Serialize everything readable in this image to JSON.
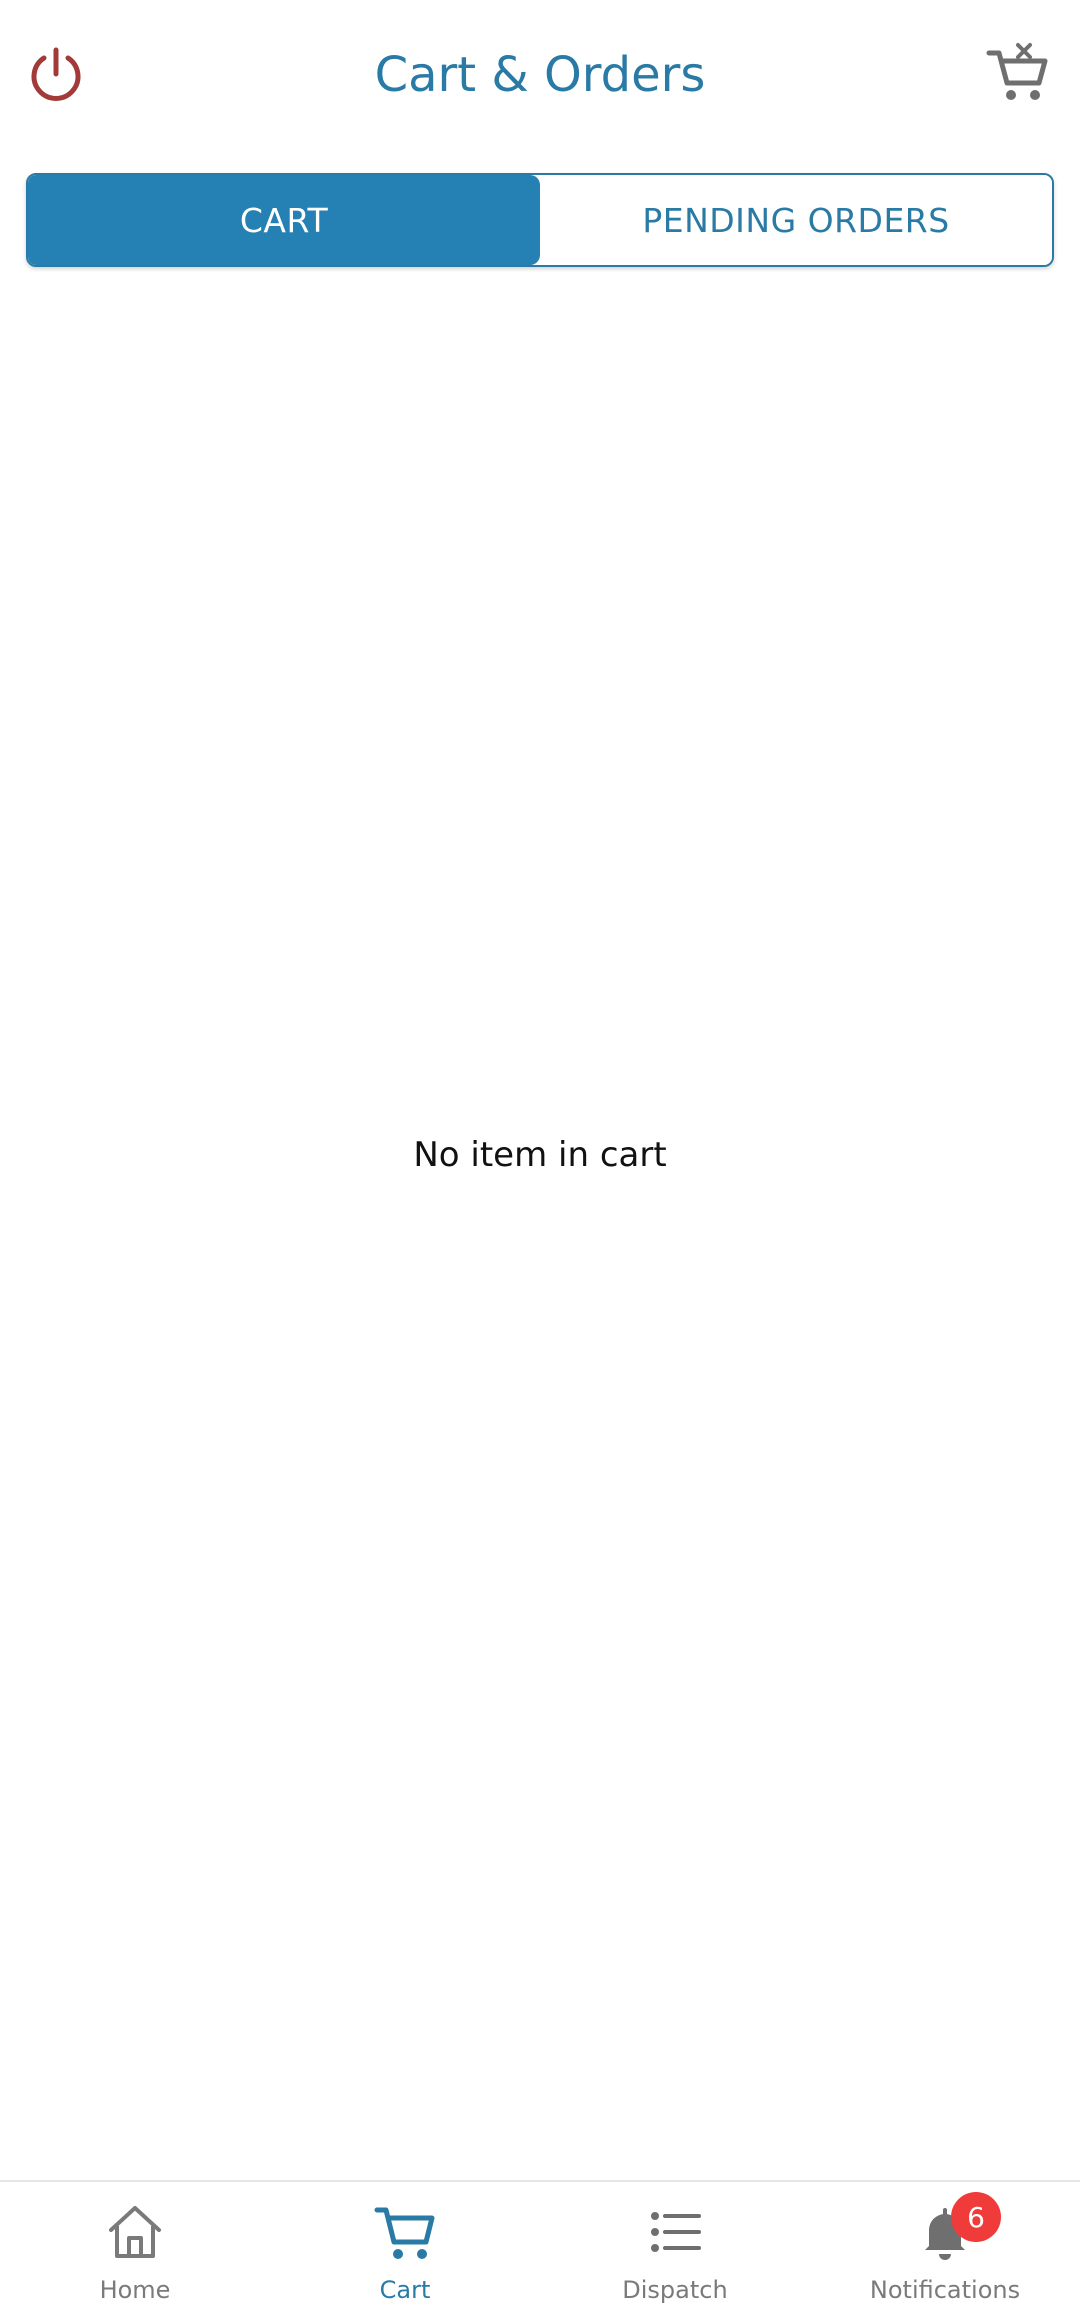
{
  "header": {
    "title": "Cart & Orders",
    "power_icon": "power-icon",
    "clear_cart_icon": "cart-remove-icon"
  },
  "tabs": [
    {
      "label": "CART",
      "active": true
    },
    {
      "label": "PENDING ORDERS",
      "active": false
    }
  ],
  "main": {
    "empty_message": "No item in cart"
  },
  "bottom_nav": {
    "items": [
      {
        "label": "Home",
        "icon": "home-icon",
        "active": false
      },
      {
        "label": "Cart",
        "icon": "cart-icon",
        "active": true
      },
      {
        "label": "Dispatch",
        "icon": "list-icon",
        "active": false
      },
      {
        "label": "Notifications",
        "icon": "bell-icon",
        "active": false,
        "badge": "6"
      }
    ]
  },
  "colors": {
    "primary": "#2580b3",
    "title": "#2a7aa6",
    "power": "#a33a3a",
    "badge": "#f03b3b",
    "inactive": "#7a7a7a"
  }
}
